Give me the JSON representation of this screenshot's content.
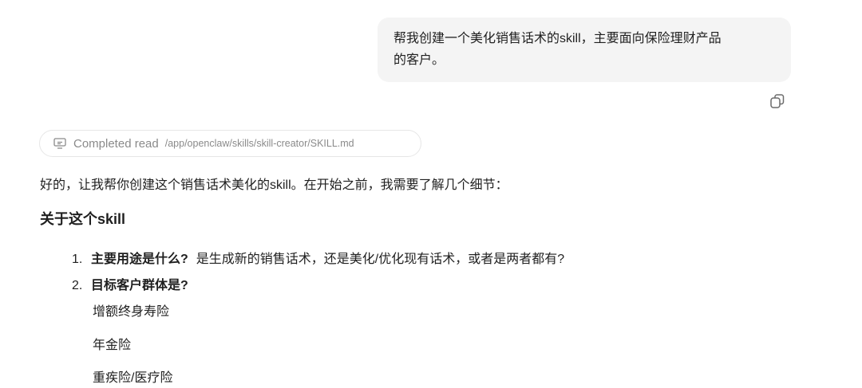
{
  "user_message": {
    "line1": "帮我创建一个美化销售话术的skill，主要面向保险理财产品",
    "line2": "的客户。"
  },
  "tool_call": {
    "status": "Completed read",
    "path": "/app/openclaw/skills/skill-creator/SKILL.md"
  },
  "assistant": {
    "intro": "好的，让我帮你创建这个销售话术美化的skill。在开始之前，我需要了解几个细节：",
    "section_title": "关于这个skill",
    "questions": [
      {
        "num": "1.",
        "title": "主要用途是什么?",
        "text": "是生成新的销售话术，还是美化/优化现有话术，或者是两者都有?"
      },
      {
        "num": "2.",
        "title": "目标客户群体是?",
        "text": ""
      }
    ],
    "sub_items": [
      "增额终身寿险",
      "年金险",
      "重疾险/医疗险"
    ]
  },
  "icons": {
    "copy": "copy-icon",
    "tool": "monitor-icon"
  },
  "colors": {
    "bubble_bg": "#f4f4f4",
    "muted_text": "#8a8a8a",
    "chip_border": "#e6e6e6"
  }
}
